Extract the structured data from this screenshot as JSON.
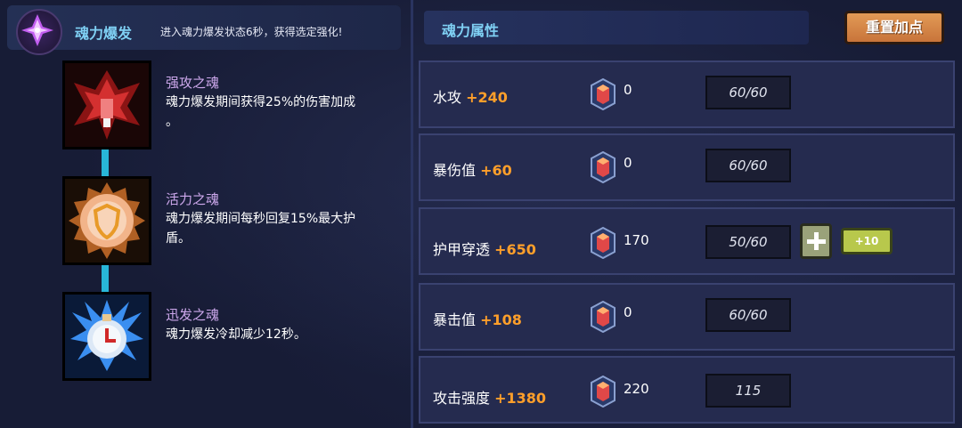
{
  "burst": {
    "icon": "soul-burst-crystal-icon",
    "title": "魂力爆发",
    "description": "进入魂力爆发状态6秒，获得选定强化!"
  },
  "souls": [
    {
      "icon": "red-beast-soul-icon",
      "name": "强攻之魂",
      "desc_line1": "魂力爆发期间获得25%的伤害加成",
      "desc_line2": "。"
    },
    {
      "icon": "orange-shield-soul-icon",
      "name": "活力之魂",
      "desc_line1": "魂力爆发期间每秒回复15%最大护",
      "desc_line2": "盾。"
    },
    {
      "icon": "blue-clock-soul-icon",
      "name": "迅发之魂",
      "desc_line1": "魂力爆发冷却减少12秒。",
      "desc_line2": ""
    }
  ],
  "attributes": {
    "title": "魂力属性",
    "reset_label": "重置加点"
  },
  "stats": [
    {
      "name": "水攻",
      "bonus": "+240",
      "points": "0",
      "cap": "60/60"
    },
    {
      "name": "暴伤值",
      "bonus": "+60",
      "points": "0",
      "cap": "60/60"
    },
    {
      "name": "护甲穿透",
      "bonus": "+650",
      "points": "170",
      "cap": "50/60",
      "plus10": "+10"
    },
    {
      "name": "暴击值",
      "bonus": "+108",
      "points": "0",
      "cap": "60/60"
    },
    {
      "name": "攻击强度",
      "bonus": "+1380",
      "points": "220",
      "cap": "115"
    }
  ],
  "colors": {
    "accent_blue": "#7fd0f4",
    "bonus_orange": "#ff9f2a",
    "soul_name_purple": "#cda8ec",
    "reset_orange": "#d9874a"
  }
}
